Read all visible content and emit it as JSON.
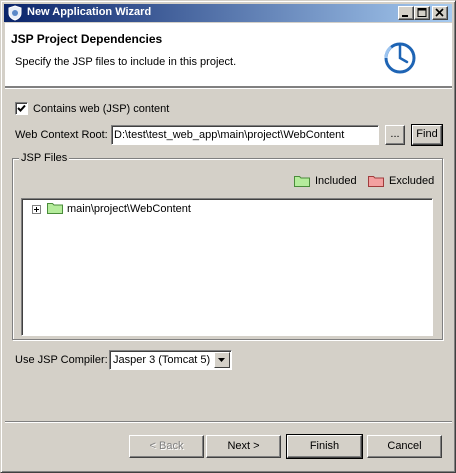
{
  "window": {
    "title": "New Application Wizard"
  },
  "header": {
    "title": "JSP Project Dependencies",
    "description": "Specify the JSP files to include in this project."
  },
  "web_content": {
    "checkbox_label": "Contains web (JSP) content",
    "checked": true,
    "context_root_label": "Web Context Root:",
    "context_root_value": "D:\\test\\test_web_app\\main\\project\\WebContent",
    "browse_label": "...",
    "find_label": "Find"
  },
  "jsp_files": {
    "group_title": "JSP Files",
    "legend_included": "Included",
    "legend_excluded": "Excluded",
    "tree_items": [
      {
        "label": "main\\project\\WebContent",
        "expanded": false
      }
    ]
  },
  "compiler": {
    "label": "Use JSP Compiler:",
    "selected": "Jasper 3 (Tomcat 5)"
  },
  "footer": {
    "back_label": "< Back",
    "next_label": "Next >",
    "finish_label": "Finish",
    "cancel_label": "Cancel"
  },
  "colors": {
    "included": "#b5ec9c",
    "excluded": "#f3a0a0",
    "titlebar_start": "#0a246a",
    "titlebar_end": "#a6caf0"
  }
}
